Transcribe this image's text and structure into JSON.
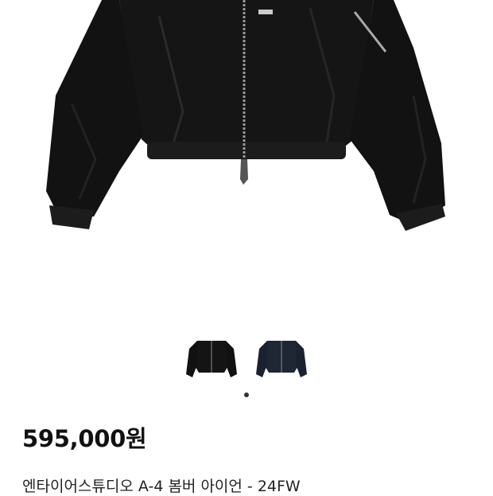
{
  "product": {
    "price": "595,000원",
    "title": "엔타이어스튜디오 A-4 봄버 아이언 - 24FW"
  },
  "gallery": {
    "thumbnails": [
      {
        "icon": "black-bomber-jacket-thumbnail",
        "color": "#1a1a1a"
      },
      {
        "icon": "navy-bomber-jacket-thumbnail",
        "color": "#1f2735"
      }
    ],
    "active_index": 0
  },
  "colors": {
    "jacket_black": "#141414",
    "jacket_navy": "#1f2735",
    "dot_active": "#333333"
  }
}
